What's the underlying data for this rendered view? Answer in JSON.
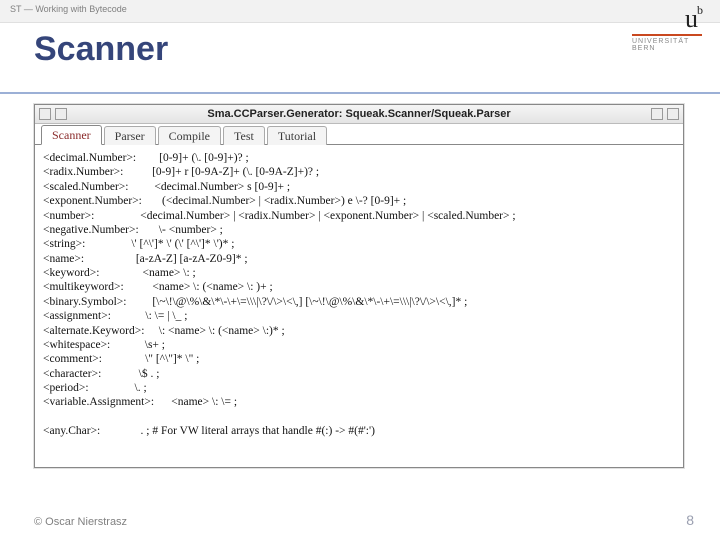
{
  "header": {
    "left": "ST — Working with Bytecode"
  },
  "logo": {
    "ub_u": "u",
    "ub_b": "b",
    "line1": "UNIVERSITÄT",
    "line2": "BERN"
  },
  "title": "Scanner",
  "window": {
    "titlebar": "Sma.CCParser.Generator: Squeak.Scanner/Squeak.Parser",
    "tabs": [
      "Scanner",
      "Parser",
      "Compile",
      "Test",
      "Tutorial"
    ],
    "rules": [
      {
        "lhs": "<decimal.Number>:",
        "rhs": "[0-9]+ (\\. [0-9]+)? ;"
      },
      {
        "lhs": "<radix.Number>:",
        "rhs": "[0-9]+ r [0-9A-Z]+ (\\. [0-9A-Z]+)? ;"
      },
      {
        "lhs": "<scaled.Number>:",
        "rhs": "<decimal.Number> s [0-9]+ ;"
      },
      {
        "lhs": "<exponent.Number>:",
        "rhs": "(<decimal.Number> | <radix.Number>) e \\-? [0-9]+ ;"
      },
      {
        "lhs": "<number>:",
        "rhs": "<decimal.Number> | <radix.Number> | <exponent.Number> | <scaled.Number> ;"
      },
      {
        "lhs": "<negative.Number>:",
        "rhs": "\\- <number> ;"
      },
      {
        "lhs": "<string>:",
        "rhs": "\\' [^\\']* \\' (\\' [^\\']* \\')* ;"
      },
      {
        "lhs": "<name>:",
        "rhs": "[a-zA-Z] [a-zA-Z0-9]* ;"
      },
      {
        "lhs": "<keyword>:",
        "rhs": "<name> \\: ;"
      },
      {
        "lhs": "<multikeyword>:",
        "rhs": "<name> \\: (<name> \\: )+ ;"
      },
      {
        "lhs": "<binary.Symbol>:",
        "rhs": "[\\~\\!\\@\\%\\&\\*\\-\\+\\=\\\\\\|\\?\\/\\>\\<\\,] [\\~\\!\\@\\%\\&\\*\\-\\+\\=\\\\\\|\\?\\/\\>\\<\\,]* ;"
      },
      {
        "lhs": "<assignment>:",
        "rhs": "\\: \\= | \\_ ;"
      },
      {
        "lhs": "<alternate.Keyword>:",
        "rhs": "\\: <name> \\: (<name> \\:)* ;"
      },
      {
        "lhs": "<whitespace>:",
        "rhs": "\\s+ ;"
      },
      {
        "lhs": "<comment>:",
        "rhs": "\\\" [^\\\"]* \\\" ;"
      },
      {
        "lhs": "<character>:",
        "rhs": "\\$ . ;"
      },
      {
        "lhs": "<period>:",
        "rhs": "\\. ;"
      },
      {
        "lhs": "<variable.Assignment>:",
        "rhs": "   <name> \\: \\= ;"
      }
    ],
    "gap_rule": {
      "lhs": "<any.Char>:",
      "rhs": ". ; # For VW literal arrays that handle #(:) -> #(#':')"
    }
  },
  "footer": {
    "copyright": "© Oscar Nierstrasz",
    "page": "8"
  }
}
